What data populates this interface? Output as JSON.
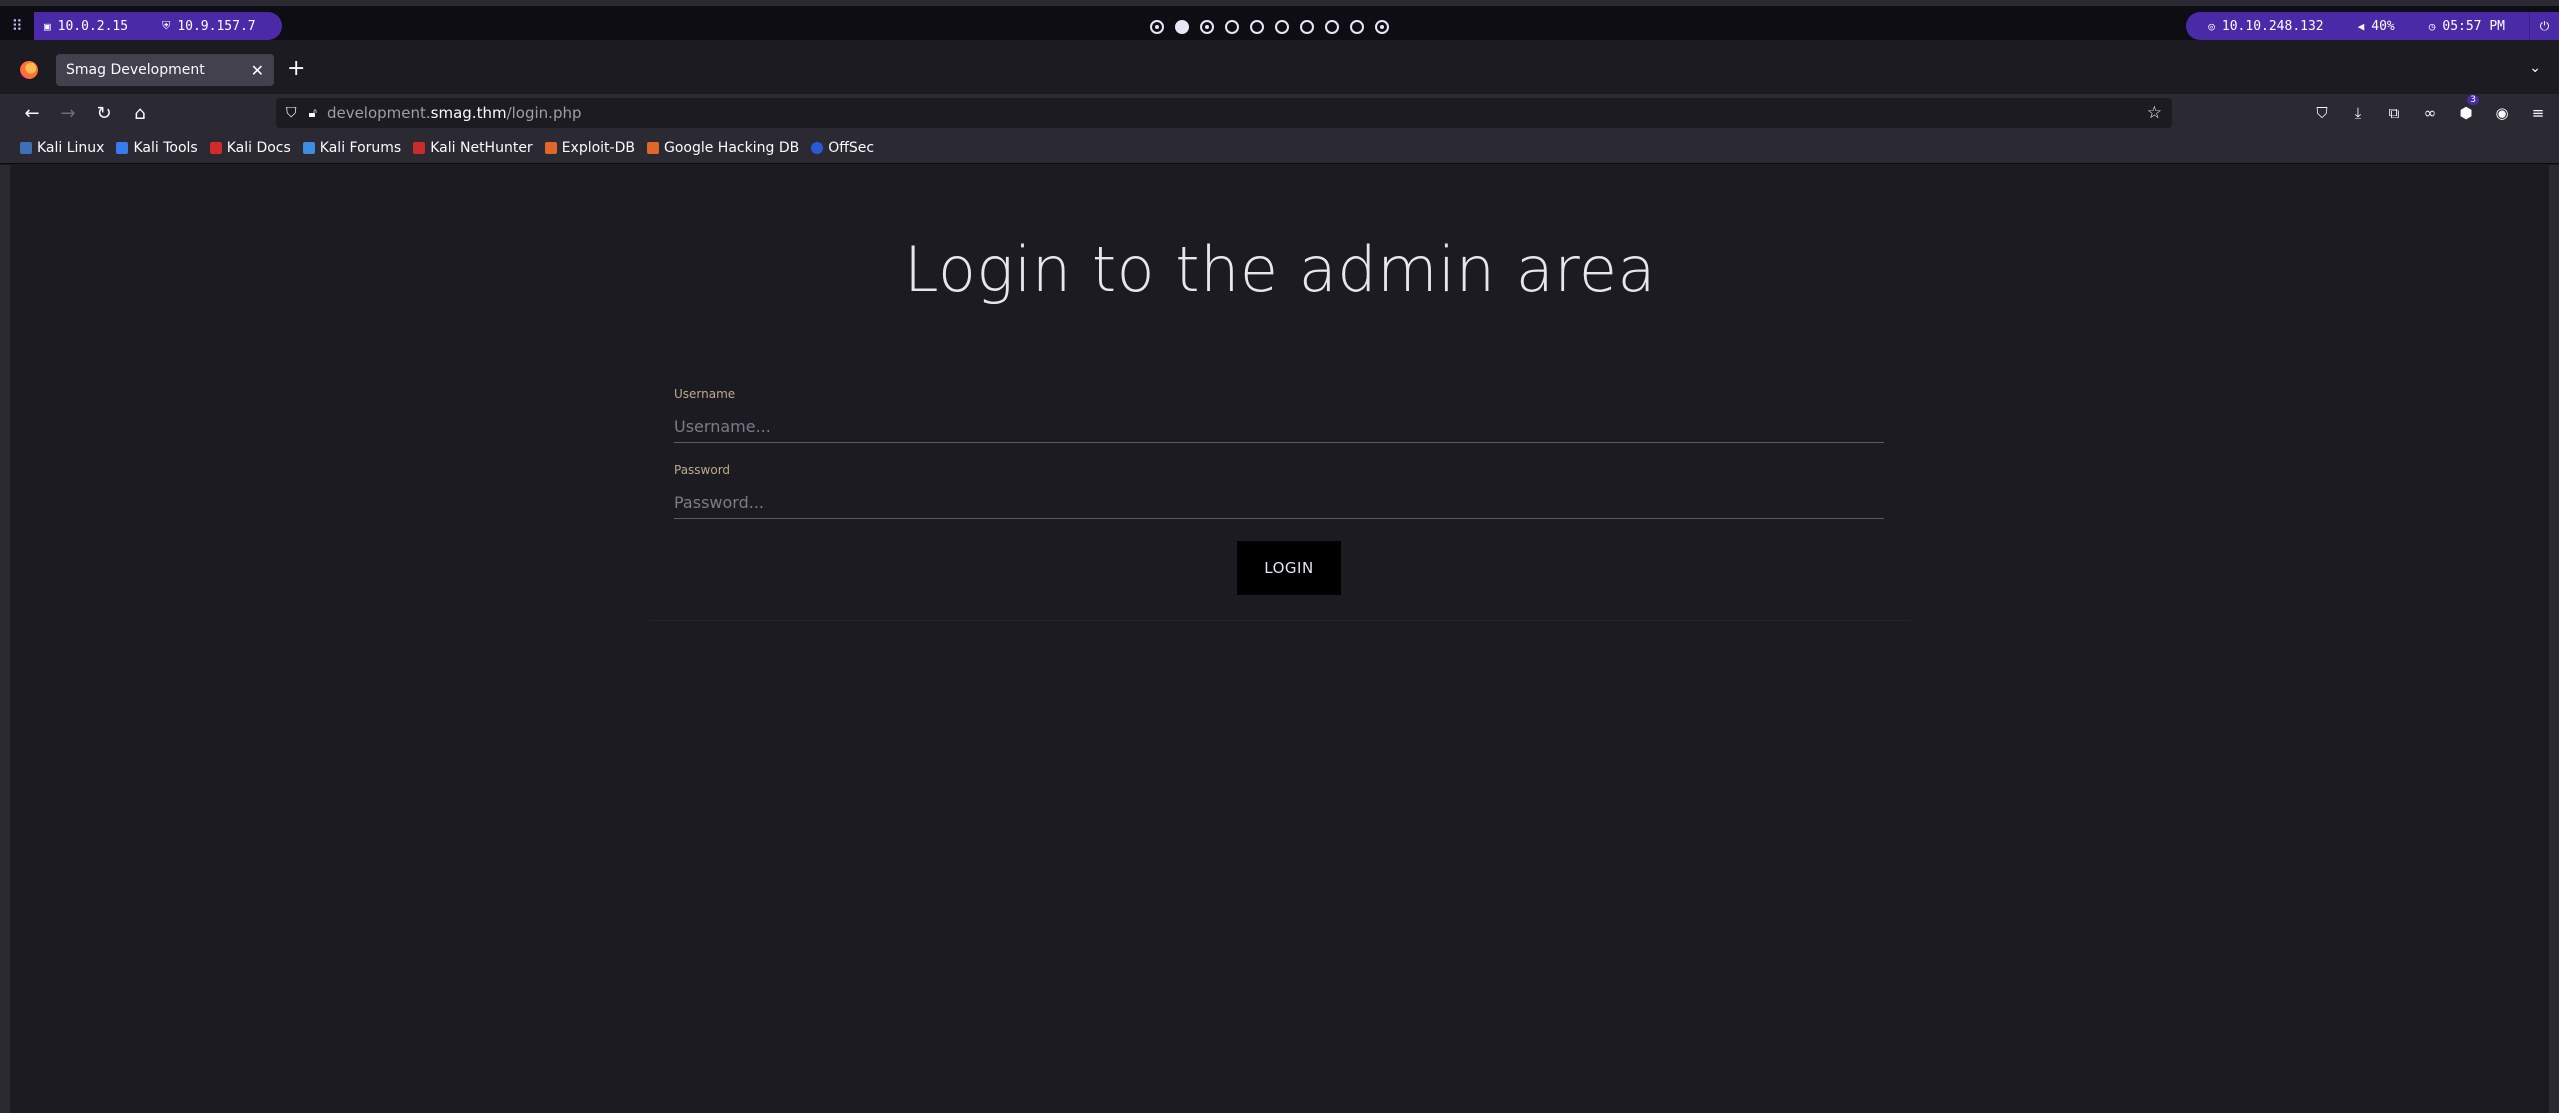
{
  "system_bar": {
    "menu_icon": "grid-icon",
    "left_items": [
      {
        "icon": "monitor-icon",
        "text": "10.0.2.15"
      },
      {
        "icon": "shield-icon",
        "text": "10.9.157.7"
      }
    ],
    "workspaces": 10,
    "active_workspace": 2,
    "right_items": [
      {
        "icon": "target-icon",
        "text": "10.10.248.132"
      },
      {
        "icon": "speaker-icon",
        "text": "40%"
      },
      {
        "icon": "clock-icon",
        "text": "05:57 PM"
      }
    ],
    "power_icon": "power-icon"
  },
  "browser": {
    "tab_title": "Smag Development",
    "url_prefix": "development.",
    "url_host": "smag.thm",
    "url_path": "/login.php",
    "bookmarks": [
      {
        "label": "Kali Linux",
        "color": "#3f6fb5"
      },
      {
        "label": "Kali Tools",
        "color": "#367bf0"
      },
      {
        "label": "Kali Docs",
        "color": "#d12a2a"
      },
      {
        "label": "Kali Forums",
        "color": "#3b8de0"
      },
      {
        "label": "Kali NetHunter",
        "color": "#cc2b2b"
      },
      {
        "label": "Exploit-DB",
        "color": "#e0662a"
      },
      {
        "label": "Google Hacking DB",
        "color": "#e0662a"
      },
      {
        "label": "OffSec",
        "color": "#2a5bd6"
      }
    ],
    "extension_badge": "3"
  },
  "page": {
    "title": "Login to the admin area",
    "username_label": "Username",
    "username_placeholder": "Username...",
    "password_label": "Password",
    "password_placeholder": "Password...",
    "login_label": "LOGIN"
  }
}
